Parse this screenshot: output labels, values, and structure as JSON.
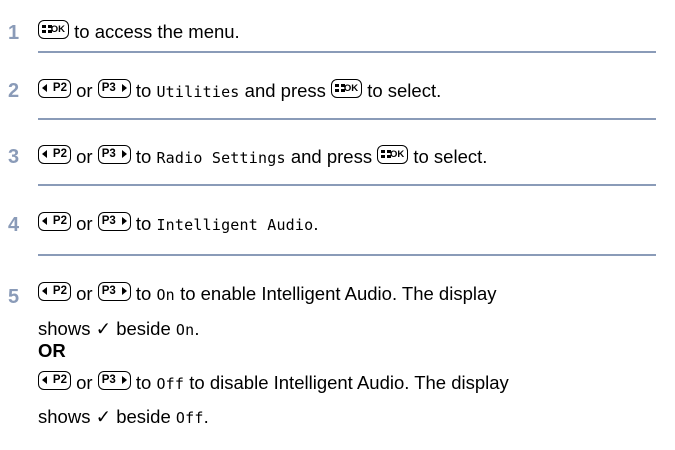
{
  "colors": {
    "step_number": "#8a9bb8",
    "separator": "#8a9bb8"
  },
  "keys": {
    "ok": "OK",
    "p2": "P2",
    "p3": "P3"
  },
  "steps": [
    {
      "number": "1",
      "text_after_ok": "to access the menu."
    },
    {
      "number": "2",
      "or": "or",
      "to": "to",
      "target": "Utilities",
      "and_press": "and press",
      "to_select": "to select."
    },
    {
      "number": "3",
      "or": "or",
      "to": "to",
      "target": "Radio Settings",
      "and_press": "and press",
      "to_select": "to select."
    },
    {
      "number": "4",
      "or": "or",
      "to": "to",
      "target": "Intelligent Audio",
      "period": "."
    },
    {
      "number": "5",
      "or": "or",
      "to": "to",
      "target_on": "On",
      "enable_text": "to enable Intelligent Audio. The display",
      "shows": "shows ✓ beside",
      "alt_or": "OR",
      "target_off": "Off",
      "disable_text": "to disable Intelligent Audio. The display",
      "period": "."
    }
  ]
}
